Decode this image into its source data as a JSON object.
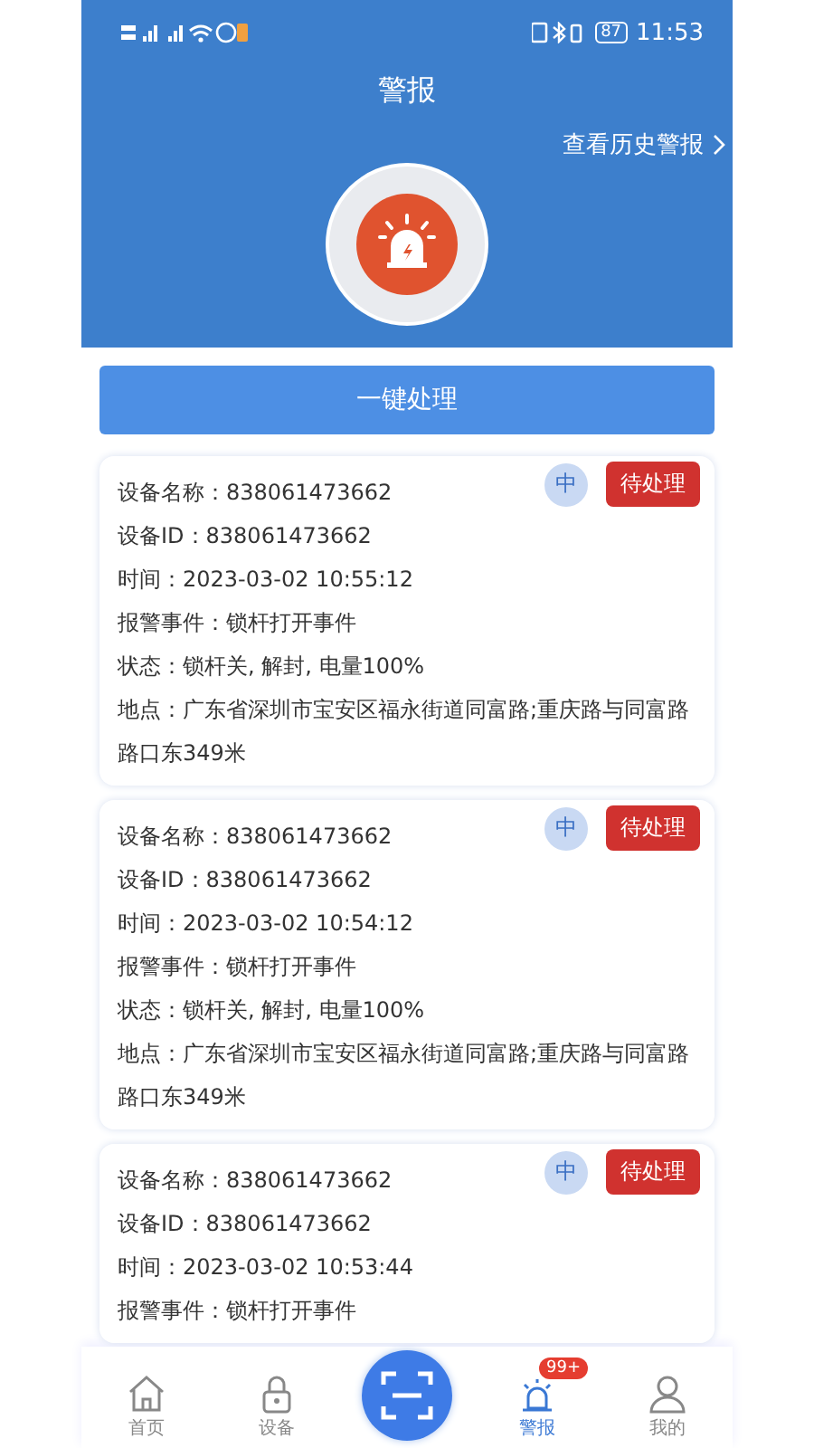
{
  "status_bar": {
    "battery": "87",
    "time": "11:53"
  },
  "header": {
    "title": "警报",
    "history_link": "查看历史警报"
  },
  "action_button": "一键处理",
  "alerts": [
    {
      "level": "中",
      "status": "待处理",
      "lines": [
        "设备名称：838061473662",
        "设备ID：838061473662",
        "时间：2023-03-02 10:55:12",
        "报警事件：锁杆打开事件",
        "状态：锁杆关, 解封, 电量100%",
        "地点：广东省深圳市宝安区福永街道同富路;重庆路与同富路路口东349米"
      ]
    },
    {
      "level": "中",
      "status": "待处理",
      "lines": [
        "设备名称：838061473662",
        "设备ID：838061473662",
        "时间：2023-03-02 10:54:12",
        "报警事件：锁杆打开事件",
        "状态：锁杆关, 解封, 电量100%",
        "地点：广东省深圳市宝安区福永街道同富路;重庆路与同富路路口东349米"
      ]
    },
    {
      "level": "中",
      "status": "待处理",
      "lines": [
        "设备名称：838061473662",
        "设备ID：838061473662",
        "时间：2023-03-02 10:53:44",
        "报警事件：锁杆打开事件"
      ]
    }
  ],
  "nav": [
    {
      "kind": "home",
      "label": "首页",
      "selected": false
    },
    {
      "kind": "lock",
      "label": "设备",
      "selected": false
    },
    {
      "kind": "scan"
    },
    {
      "kind": "alarm",
      "label": "警报",
      "selected": true,
      "badge": "99+"
    },
    {
      "kind": "user",
      "label": "我的",
      "selected": false
    }
  ]
}
